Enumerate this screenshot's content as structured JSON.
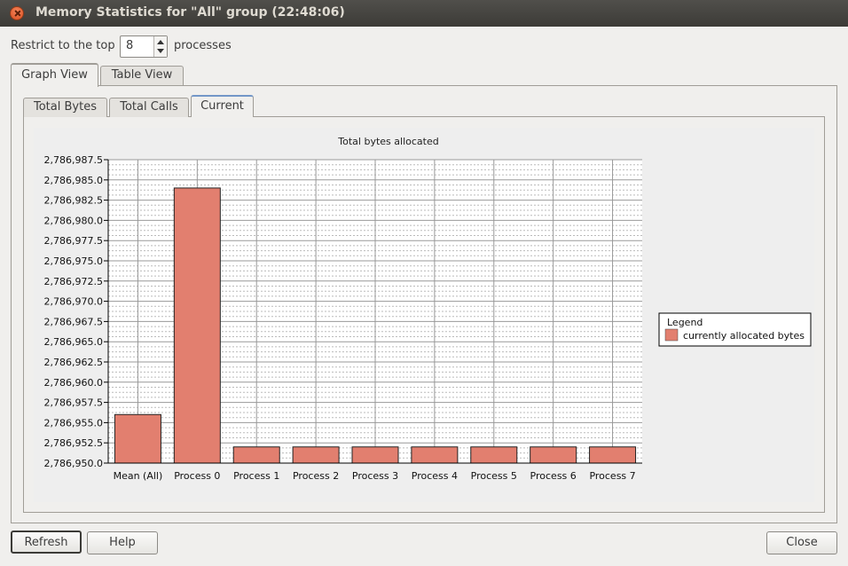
{
  "window": {
    "title": "Memory Statistics for \"All\" group (22:48:06)"
  },
  "restrict": {
    "label_before": "Restrict to the top",
    "value": "8",
    "label_after": "processes"
  },
  "outer_tabs": [
    {
      "label": "Graph View",
      "active": true
    },
    {
      "label": "Table View",
      "active": false
    }
  ],
  "inner_tabs": [
    {
      "label": "Total Bytes",
      "active": false
    },
    {
      "label": "Total Calls",
      "active": false
    },
    {
      "label": "Current",
      "active": true
    }
  ],
  "chart_data": {
    "type": "bar",
    "title": "Total bytes allocated",
    "categories": [
      "Mean (All)",
      "Process 0",
      "Process 1",
      "Process 2",
      "Process 3",
      "Process 4",
      "Process 5",
      "Process 6",
      "Process 7"
    ],
    "series": [
      {
        "name": "currently allocated bytes",
        "values": [
          2786956.0,
          2786984.0,
          2786952.0,
          2786952.0,
          2786952.0,
          2786952.0,
          2786952.0,
          2786952.0,
          2786952.0
        ]
      }
    ],
    "ylim": [
      2786950.0,
      2786987.5
    ],
    "y_ticks": [
      "2,786,950.0",
      "2,786,952.5",
      "2,786,955.0",
      "2,786,957.5",
      "2,786,960.0",
      "2,786,962.5",
      "2,786,965.0",
      "2,786,967.5",
      "2,786,970.0",
      "2,786,972.5",
      "2,786,975.0",
      "2,786,977.5",
      "2,786,980.0",
      "2,786,982.5",
      "2,786,985.0",
      "2,786,987.5"
    ],
    "legend_title": "Legend",
    "legend_position": "right",
    "bar_color": "#e27f6f",
    "grid": true
  },
  "buttons": {
    "refresh": "Refresh",
    "help": "Help",
    "close": "Close"
  }
}
